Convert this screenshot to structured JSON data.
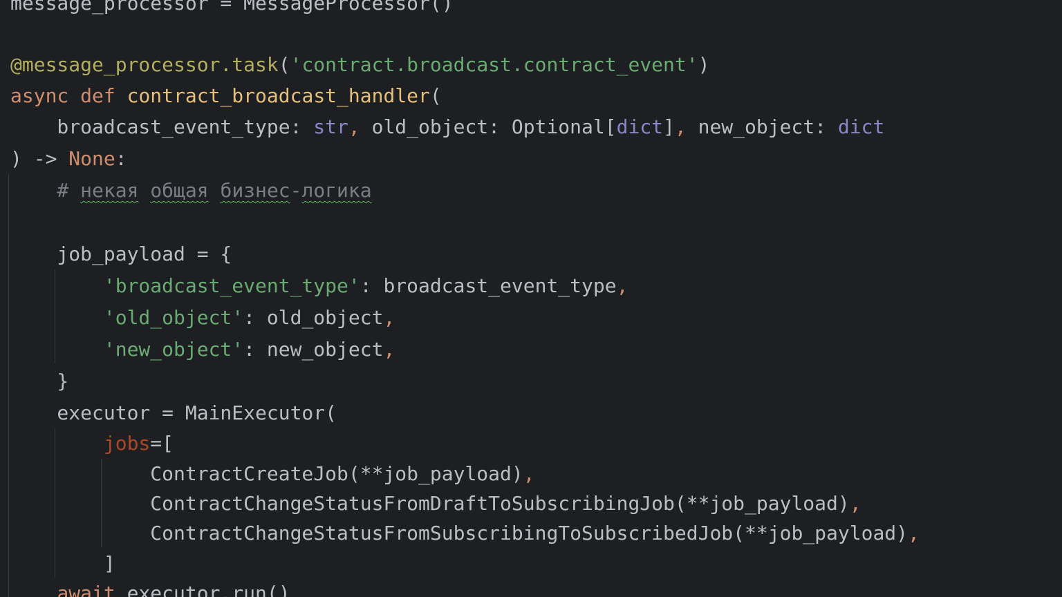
{
  "editor": {
    "background": "#1e1f22",
    "theme_colors": {
      "plain": "#bcbec4",
      "decorator": "#b3ae60",
      "string": "#6aab73",
      "keyword": "#cf8e6d",
      "function_name": "#e6c07b",
      "builtin": "#8888c6",
      "comment": "#7a7e85",
      "keyword_argument": "#aa4926"
    },
    "lines": [
      [
        {
          "t": "message_processor = MessageProcessor()",
          "c": "plain"
        }
      ],
      [],
      [
        {
          "t": "@message_processor.task",
          "c": "deco"
        },
        {
          "t": "(",
          "c": "plain"
        },
        {
          "t": "'contract.broadcast.contract_event'",
          "c": "string"
        },
        {
          "t": ")",
          "c": "plain"
        }
      ],
      [
        {
          "t": "async",
          "c": "keyword"
        },
        {
          "t": " ",
          "c": "plain"
        },
        {
          "t": "def",
          "c": "keyword"
        },
        {
          "t": " ",
          "c": "plain"
        },
        {
          "t": "contract_broadcast_handler",
          "c": "fname"
        },
        {
          "t": "(",
          "c": "plain"
        }
      ],
      [
        {
          "t": "    broadcast_event_type: ",
          "c": "plain"
        },
        {
          "t": "str",
          "c": "builtin"
        },
        {
          "t": ",",
          "c": "comma"
        },
        {
          "t": " old_object: Optional[",
          "c": "plain"
        },
        {
          "t": "dict",
          "c": "builtin"
        },
        {
          "t": "]",
          "c": "plain"
        },
        {
          "t": ",",
          "c": "comma"
        },
        {
          "t": " new_object: ",
          "c": "plain"
        },
        {
          "t": "dict",
          "c": "builtin"
        }
      ],
      [
        {
          "t": ") -> ",
          "c": "plain"
        },
        {
          "t": "None",
          "c": "keyword"
        },
        {
          "t": ":",
          "c": "plain"
        }
      ],
      [
        {
          "t": "    # ",
          "c": "comment"
        },
        {
          "t": "некая",
          "c": "comment",
          "u": true
        },
        {
          "t": " ",
          "c": "comment"
        },
        {
          "t": "общая",
          "c": "comment",
          "u": true
        },
        {
          "t": " ",
          "c": "comment"
        },
        {
          "t": "бизнес",
          "c": "comment",
          "u": true
        },
        {
          "t": "-",
          "c": "comment"
        },
        {
          "t": "логика",
          "c": "comment",
          "u": true
        }
      ],
      [],
      [
        {
          "t": "    job_payload = {",
          "c": "plain"
        }
      ],
      [
        {
          "t": "        ",
          "c": "plain"
        },
        {
          "t": "'broadcast_event_type'",
          "c": "string"
        },
        {
          "t": ": broadcast_event_type",
          "c": "plain"
        },
        {
          "t": ",",
          "c": "comma"
        }
      ],
      [
        {
          "t": "        ",
          "c": "plain"
        },
        {
          "t": "'old_object'",
          "c": "string"
        },
        {
          "t": ": old_object",
          "c": "plain"
        },
        {
          "t": ",",
          "c": "comma"
        }
      ],
      [
        {
          "t": "        ",
          "c": "plain"
        },
        {
          "t": "'new_object'",
          "c": "string"
        },
        {
          "t": ": new_object",
          "c": "plain"
        },
        {
          "t": ",",
          "c": "comma"
        }
      ],
      [
        {
          "t": "    }",
          "c": "plain"
        }
      ],
      [
        {
          "t": "    executor = MainExecutor(",
          "c": "plain"
        }
      ],
      [
        {
          "t": "        ",
          "c": "plain"
        },
        {
          "t": "jobs",
          "c": "kwarg"
        },
        {
          "t": "=[",
          "c": "plain"
        }
      ],
      [
        {
          "t": "            ContractCreateJob(**job_payload)",
          "c": "plain"
        },
        {
          "t": ",",
          "c": "comma"
        }
      ],
      [
        {
          "t": "            ContractChangeStatusFromDraftToSubscribingJob(**job_payload)",
          "c": "plain"
        },
        {
          "t": ",",
          "c": "comma"
        }
      ],
      [
        {
          "t": "            ContractChangeStatusFromSubscribingToSubscribedJob(**job_payload)",
          "c": "plain"
        },
        {
          "t": ",",
          "c": "comma"
        }
      ],
      [
        {
          "t": "        ]",
          "c": "plain"
        }
      ],
      [
        {
          "t": "    ",
          "c": "plain"
        },
        {
          "t": "await",
          "c": "keyword"
        },
        {
          "t": " executor.run()",
          "c": "plain"
        }
      ]
    ]
  }
}
